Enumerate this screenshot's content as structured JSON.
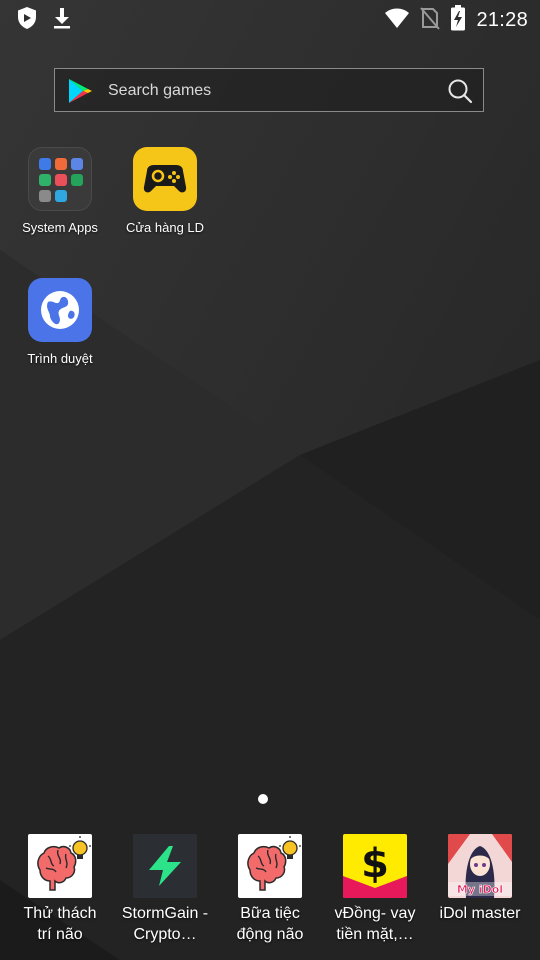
{
  "status_bar": {
    "time": "21:28",
    "left_icons": [
      "shield-icon",
      "download-icon"
    ],
    "right_icons": [
      "wifi-icon",
      "no-sim-icon",
      "battery-charging-icon"
    ]
  },
  "search": {
    "placeholder": "Search games",
    "play_icon": "google-play-icon",
    "search_icon": "search-icon"
  },
  "home_apps": [
    {
      "label": "System Apps",
      "icon": "folder-icon"
    },
    {
      "label": "Cửa hàng LD",
      "icon": "gamepad-icon",
      "color": "#F5C518"
    },
    {
      "label": "Trình duyệt",
      "icon": "globe-icon",
      "color": "#4A74E8"
    }
  ],
  "page_indicator": {
    "pages": 1,
    "current": 1
  },
  "dock": [
    {
      "line1": "Thử thách",
      "line2": "trí não",
      "icon": "brain-bulb-icon"
    },
    {
      "line1": "StormGain -",
      "line2": "Crypto…",
      "icon": "stormgain-icon",
      "color": "#2CE38A"
    },
    {
      "line1": "Bữa tiệc",
      "line2": "động não",
      "icon": "brain-bulb-icon"
    },
    {
      "line1": "vĐồng- vay",
      "line2": "tiền mặt,…",
      "icon": "dollar-icon",
      "color": "#FFEB00"
    },
    {
      "line1": "iDol master",
      "line2": "",
      "icon": "idol-master-icon"
    }
  ],
  "idol_logo_text": "My iDol"
}
